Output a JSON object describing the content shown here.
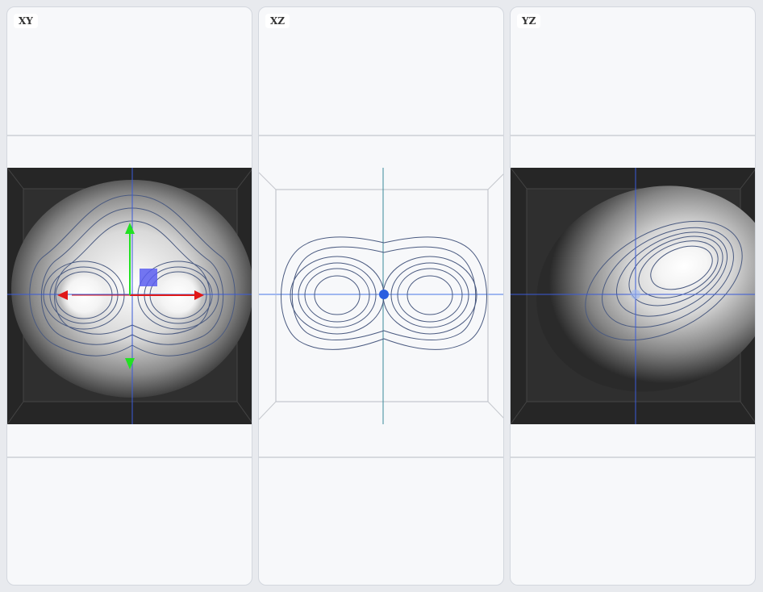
{
  "panels": [
    {
      "label": "XY",
      "render": "image",
      "crosshair_color": "#3a5bd8"
    },
    {
      "label": "XZ",
      "render": "wireframe",
      "crosshair_color": "#4b8ef0"
    },
    {
      "label": "YZ",
      "render": "image",
      "crosshair_color": "#3a5bd8"
    }
  ],
  "gizmo": {
    "x_axis_color": "#e01818",
    "y_axis_color": "#22e022",
    "z_handle_color": "#5a5ef0"
  },
  "marker_color": "#2a5ee0",
  "contour_color": "#4a5a80"
}
